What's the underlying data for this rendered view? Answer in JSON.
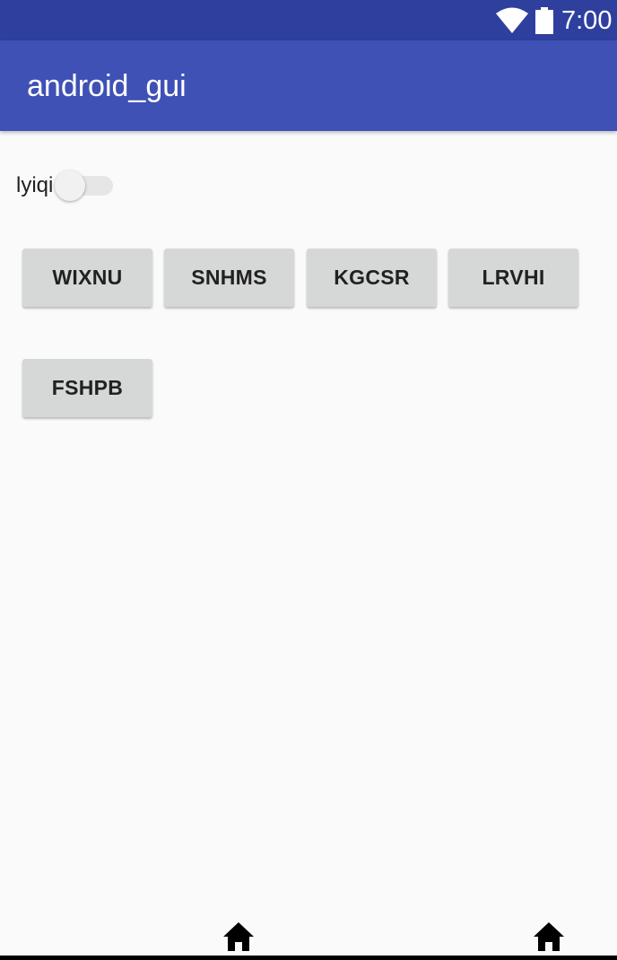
{
  "status_bar": {
    "time": "7:00",
    "icons": [
      "wifi-icon",
      "battery-icon"
    ]
  },
  "app_bar": {
    "title": "android_gui"
  },
  "switch": {
    "label": "lyiqi",
    "checked": false
  },
  "buttons": [
    {
      "label": "WIXNU"
    },
    {
      "label": "SNHMS"
    },
    {
      "label": "KGCSR"
    },
    {
      "label": "LRVHI"
    },
    {
      "label": "FSHPB"
    }
  ],
  "nav_bar": {
    "icons": [
      "home-icon",
      "home-icon"
    ]
  },
  "colors": {
    "status_bar": "#2f3f9e",
    "app_bar": "#3f51b5",
    "background": "#fafafa",
    "button": "#d6d7d7"
  }
}
